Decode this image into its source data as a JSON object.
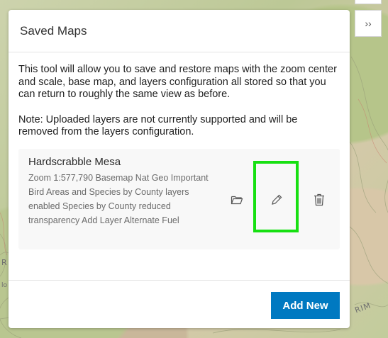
{
  "panel": {
    "title": "Saved Maps",
    "intro": "This tool will allow you to save and restore maps with the zoom center and scale, base map, and layers configuration all stored so that you can return to roughly the same view as before.",
    "note": "Note: Uploaded layers are not currently supported and will be removed from the layers configuration."
  },
  "saved_maps": [
    {
      "name": "Hardscrabble Mesa",
      "description": "Zoom 1:577,790 Basemap Nat Geo Important Bird Areas and Species by County layers enabled Species by County reduced transparency Add Layer Alternate Fuel"
    }
  ],
  "actions": {
    "add_new": "Add New"
  },
  "expand_glyph": "››",
  "map_labels": {
    "rim": "RIM",
    "r": "R",
    "lo": "lo"
  },
  "icons": {
    "open": "folder-open-icon",
    "edit": "pencil-icon",
    "delete": "trash-icon",
    "expand": "double-chevron-right-icon"
  },
  "colors": {
    "accent": "#0079c1",
    "highlight": "#17e012"
  }
}
